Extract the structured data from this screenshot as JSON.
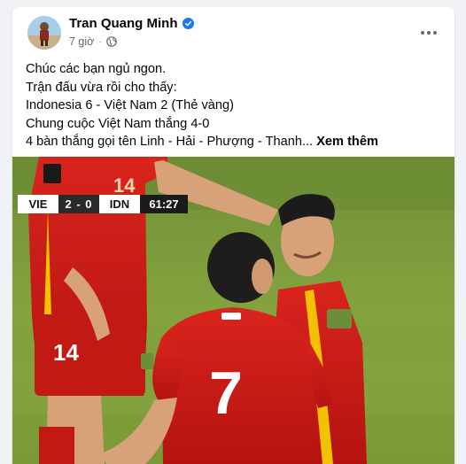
{
  "post": {
    "author": "Tran Quang Minh",
    "time": "7 giờ",
    "lines": [
      "Chúc các bạn ngủ ngon.",
      "Trận đấu vừa rồi cho thấy:",
      "Indonesia 6 - Việt Nam 2 (Thẻ vàng)",
      "Chung cuộc Việt Nam thắng 4-0"
    ],
    "last_line": "4 bàn thắng gọi tên Linh - Hải - Phượng - Thanh...",
    "see_more": "Xem thêm"
  },
  "scoreboard": {
    "home": "VIE",
    "score": "2 - 0",
    "away": "IDN",
    "time": "61:27"
  },
  "jerseys": {
    "left": "14",
    "center": "7"
  },
  "icons": {
    "verified": "verified-badge-icon",
    "privacy": "globe-icon",
    "more": "more-options-icon"
  }
}
